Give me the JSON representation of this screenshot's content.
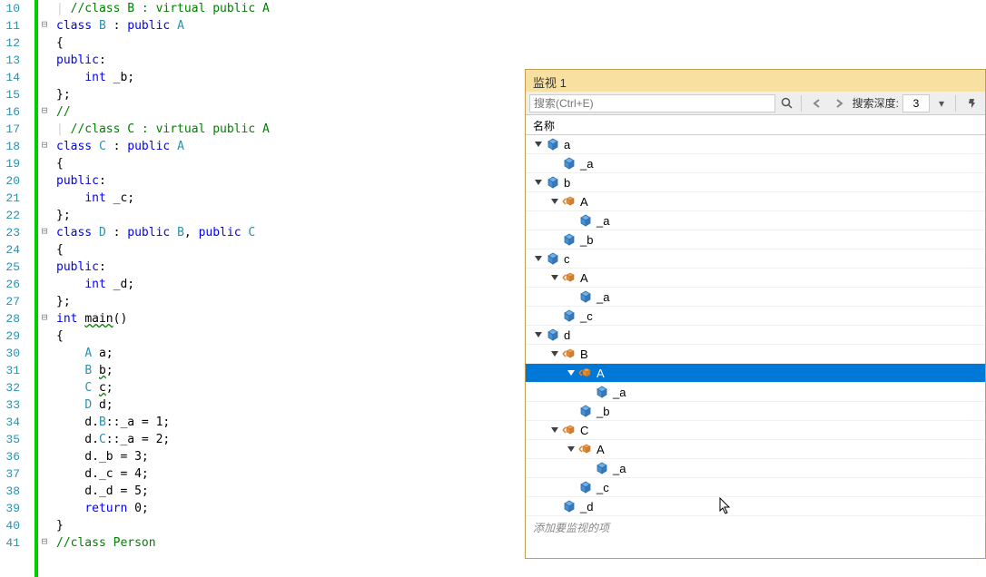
{
  "editor": {
    "lines": [
      {
        "num": "10",
        "fold": "",
        "html": "<span class='guide'>|</span> <span class='comment'>//class B : virtual public A</span>"
      },
      {
        "num": "11",
        "fold": "⊟",
        "html": "<span class='kw'>class</span> <span class='type'>B</span> : <span class='kw'>public</span> <span class='type'>A</span>"
      },
      {
        "num": "12",
        "fold": "",
        "html": "{"
      },
      {
        "num": "13",
        "fold": "",
        "html": "<span class='kw'>public</span>:"
      },
      {
        "num": "14",
        "fold": "",
        "html": "    <span class='kw'>int</span> _b;"
      },
      {
        "num": "15",
        "fold": "",
        "html": "};"
      },
      {
        "num": "16",
        "fold": "⊟",
        "html": "<span class='comment'>//</span>"
      },
      {
        "num": "17",
        "fold": "",
        "html": "<span class='guide'>|</span> <span class='comment'>//class C : virtual public A</span>"
      },
      {
        "num": "18",
        "fold": "⊟",
        "html": "<span class='kw'>class</span> <span class='type'>C</span> : <span class='kw'>public</span> <span class='type'>A</span>"
      },
      {
        "num": "19",
        "fold": "",
        "html": "{"
      },
      {
        "num": "20",
        "fold": "",
        "html": "<span class='kw'>public</span>:"
      },
      {
        "num": "21",
        "fold": "",
        "html": "    <span class='kw'>int</span> _c;"
      },
      {
        "num": "22",
        "fold": "",
        "html": "};"
      },
      {
        "num": "23",
        "fold": "⊟",
        "html": "<span class='kw'>class</span> <span class='type'>D</span> : <span class='kw'>public</span> <span class='type'>B</span>, <span class='kw'>public</span> <span class='type'>C</span>"
      },
      {
        "num": "24",
        "fold": "",
        "html": "{"
      },
      {
        "num": "25",
        "fold": "",
        "html": "<span class='kw'>public</span>:"
      },
      {
        "num": "26",
        "fold": "",
        "html": "    <span class='kw'>int</span> _d;"
      },
      {
        "num": "27",
        "fold": "",
        "html": "};"
      },
      {
        "num": "28",
        "fold": "⊟",
        "html": "<span class='kw'>int</span> <span class='squiggle'>main</span>()"
      },
      {
        "num": "29",
        "fold": "",
        "html": "{"
      },
      {
        "num": "30",
        "fold": "",
        "html": "    <span class='type'>A</span> a;"
      },
      {
        "num": "31",
        "fold": "",
        "html": "    <span class='type'>B</span> <span class='squiggle'>b</span>;"
      },
      {
        "num": "32",
        "fold": "",
        "html": "    <span class='type'>C</span> <span class='squiggle'>c</span>;"
      },
      {
        "num": "33",
        "fold": "",
        "html": "    <span class='type'>D</span> d;"
      },
      {
        "num": "34",
        "fold": "",
        "html": "    d.<span class='type'>B</span>::_a = 1;"
      },
      {
        "num": "35",
        "fold": "",
        "html": "    d.<span class='type'>C</span>::_a = 2;"
      },
      {
        "num": "36",
        "fold": "",
        "html": "    d._b = 3;"
      },
      {
        "num": "37",
        "fold": "",
        "html": "    d._c = 4;"
      },
      {
        "num": "38",
        "fold": "",
        "html": "    d._d = 5;"
      },
      {
        "num": "39",
        "fold": "",
        "html": "    <span class='kw'>return</span> 0;"
      },
      {
        "num": "40",
        "fold": "",
        "html": "}"
      },
      {
        "num": "41",
        "fold": "⊟",
        "html": "<span class='comment'>//class Person</span>"
      }
    ]
  },
  "watch": {
    "title": "监视 1",
    "search_placeholder": "搜索(Ctrl+E)",
    "depth_label": "搜索深度:",
    "depth_value": "3",
    "header_name": "名称",
    "add_item": "添加要监视的项",
    "tree": [
      {
        "depth": 0,
        "expanded": true,
        "icon": "cube",
        "label": "a"
      },
      {
        "depth": 1,
        "expanded": false,
        "icon": "cube",
        "label": "_a"
      },
      {
        "depth": 0,
        "expanded": true,
        "icon": "cube",
        "label": "b"
      },
      {
        "depth": 1,
        "expanded": true,
        "icon": "base",
        "label": "A"
      },
      {
        "depth": 2,
        "expanded": false,
        "icon": "cube",
        "label": "_a"
      },
      {
        "depth": 1,
        "expanded": false,
        "icon": "cube",
        "label": "_b"
      },
      {
        "depth": 0,
        "expanded": true,
        "icon": "cube",
        "label": "c"
      },
      {
        "depth": 1,
        "expanded": true,
        "icon": "base",
        "label": "A"
      },
      {
        "depth": 2,
        "expanded": false,
        "icon": "cube",
        "label": "_a"
      },
      {
        "depth": 1,
        "expanded": false,
        "icon": "cube",
        "label": "_c"
      },
      {
        "depth": 0,
        "expanded": true,
        "icon": "cube",
        "label": "d"
      },
      {
        "depth": 1,
        "expanded": true,
        "icon": "base",
        "label": "B"
      },
      {
        "depth": 2,
        "expanded": true,
        "icon": "base",
        "label": "A",
        "selected": true
      },
      {
        "depth": 3,
        "expanded": false,
        "icon": "cube",
        "label": "_a"
      },
      {
        "depth": 2,
        "expanded": false,
        "icon": "cube",
        "label": "_b"
      },
      {
        "depth": 1,
        "expanded": true,
        "icon": "base",
        "label": "C"
      },
      {
        "depth": 2,
        "expanded": true,
        "icon": "base",
        "label": "A"
      },
      {
        "depth": 3,
        "expanded": false,
        "icon": "cube",
        "label": "_a"
      },
      {
        "depth": 2,
        "expanded": false,
        "icon": "cube",
        "label": "_c"
      },
      {
        "depth": 1,
        "expanded": false,
        "icon": "cube",
        "label": "_d"
      }
    ]
  }
}
